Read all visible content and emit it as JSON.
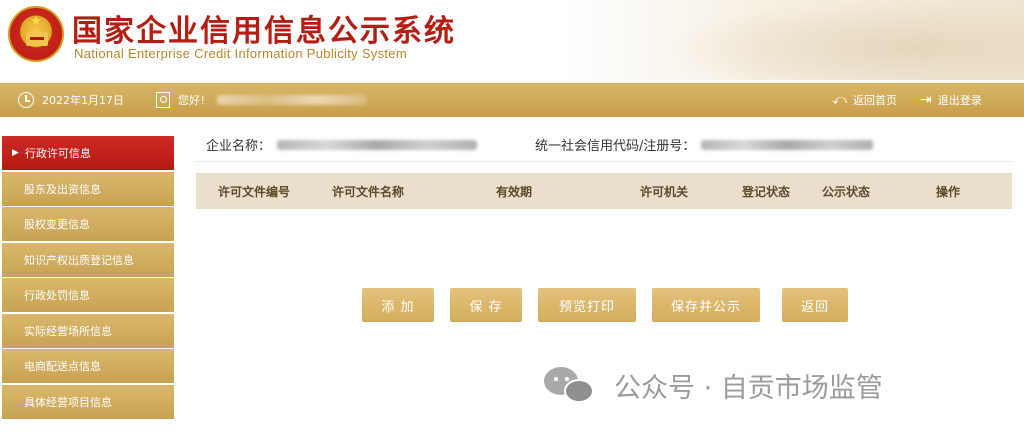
{
  "header": {
    "title_cn": "国家企业信用信息公示系统",
    "title_en": "National Enterprise Credit Information Publicity System"
  },
  "topbar": {
    "date": "2022年1月17日",
    "greeting": "您好！",
    "home_link": "返回首页",
    "logout_link": "退出登录",
    "icons": [
      "clock-icon",
      "user-icon",
      "back-icon",
      "logout-icon"
    ]
  },
  "sidebar": {
    "items": [
      {
        "label": "行政许可信息",
        "active": true
      },
      {
        "label": "股东及出资信息",
        "active": false
      },
      {
        "label": "股权变更信息",
        "active": false
      },
      {
        "label": "知识产权出质登记信息",
        "active": false
      },
      {
        "label": "行政处罚信息",
        "active": false
      },
      {
        "label": "实际经营场所信息",
        "active": false
      },
      {
        "label": "电商配送点信息",
        "active": false
      },
      {
        "label": "具体经营项目信息",
        "active": false
      }
    ]
  },
  "main": {
    "company_label": "企业名称：",
    "credit_code_label": "统一社会信用代码/注册号：",
    "columns": [
      "许可文件编号",
      "许可文件名称",
      "有效期",
      "许可机关",
      "登记状态",
      "公示状态",
      "操作"
    ],
    "rows": [],
    "buttons": {
      "add": "添 加",
      "save": "保 存",
      "preview_print": "预览打印",
      "save_publish": "保存并公示",
      "back": "返回"
    }
  },
  "watermark": {
    "text": "公众号 · 自贡市场监管"
  },
  "colors": {
    "brand_red": "#b21e14",
    "gold": "#c9a253",
    "table_header": "#eadfca"
  }
}
